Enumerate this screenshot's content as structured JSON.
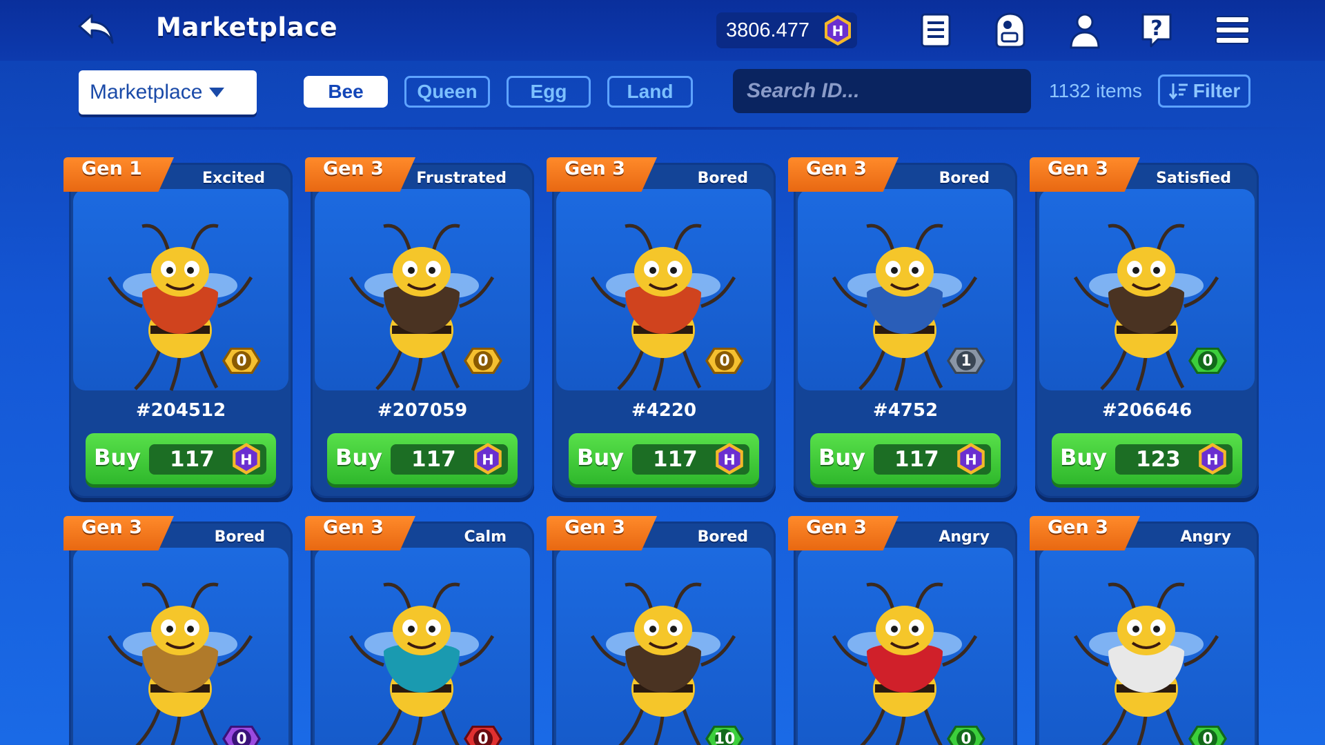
{
  "header": {
    "title": "Marketplace",
    "balance": "3806.477"
  },
  "toolbar": {
    "dropdown_label": "Marketplace",
    "tabs": [
      {
        "label": "Bee",
        "active": true
      },
      {
        "label": "Queen",
        "active": false
      },
      {
        "label": "Egg",
        "active": false
      },
      {
        "label": "Land",
        "active": false
      }
    ],
    "search_placeholder": "Search ID...",
    "items_count": "1132 items",
    "filter_label": "Filter"
  },
  "colors": {
    "accent_orange": "#ff8a2a",
    "buy_green": "#3fc83a",
    "coin_purple": "#6a2fd0",
    "badge_gold": "#f0b020",
    "badge_silver": "#6b7785",
    "badge_green": "#2fb82c",
    "badge_purple": "#7a2fd0",
    "badge_red": "#d0202a"
  },
  "cards": [
    {
      "gen": "Gen 1",
      "mood": "Excited",
      "id": "#204512",
      "buy_label": "Buy",
      "price": "117",
      "badge": "0",
      "badge_color": "gold",
      "outfit": "#d0431e"
    },
    {
      "gen": "Gen 3",
      "mood": "Frustrated",
      "id": "#207059",
      "buy_label": "Buy",
      "price": "117",
      "badge": "0",
      "badge_color": "gold",
      "outfit": "#4a3322"
    },
    {
      "gen": "Gen 3",
      "mood": "Bored",
      "id": "#4220",
      "buy_label": "Buy",
      "price": "117",
      "badge": "0",
      "badge_color": "gold",
      "outfit": "#d0431e"
    },
    {
      "gen": "Gen 3",
      "mood": "Bored",
      "id": "#4752",
      "buy_label": "Buy",
      "price": "117",
      "badge": "1",
      "badge_color": "silver",
      "outfit": "#2a5eb8"
    },
    {
      "gen": "Gen 3",
      "mood": "Satisfied",
      "id": "#206646",
      "buy_label": "Buy",
      "price": "123",
      "badge": "0",
      "badge_color": "green",
      "outfit": "#4a3322"
    },
    {
      "gen": "Gen 3",
      "mood": "Bored",
      "badge": "0",
      "badge_color": "purple",
      "outfit": "#b07a2a"
    },
    {
      "gen": "Gen 3",
      "mood": "Calm",
      "badge": "0",
      "badge_color": "red",
      "outfit": "#1a9ab0"
    },
    {
      "gen": "Gen 3",
      "mood": "Bored",
      "badge": "10",
      "badge_color": "green",
      "outfit": "#4a3322"
    },
    {
      "gen": "Gen 3",
      "mood": "Angry",
      "badge": "0",
      "badge_color": "green",
      "outfit": "#d0202a"
    },
    {
      "gen": "Gen 3",
      "mood": "Angry",
      "badge": "0",
      "badge_color": "green",
      "outfit": "#e8e8e8"
    }
  ],
  "icons": [
    "back-arrow-icon",
    "hive-coin-icon",
    "notes-icon",
    "backpack-icon",
    "profile-icon",
    "help-icon",
    "menu-icon",
    "filter-sort-icon"
  ]
}
